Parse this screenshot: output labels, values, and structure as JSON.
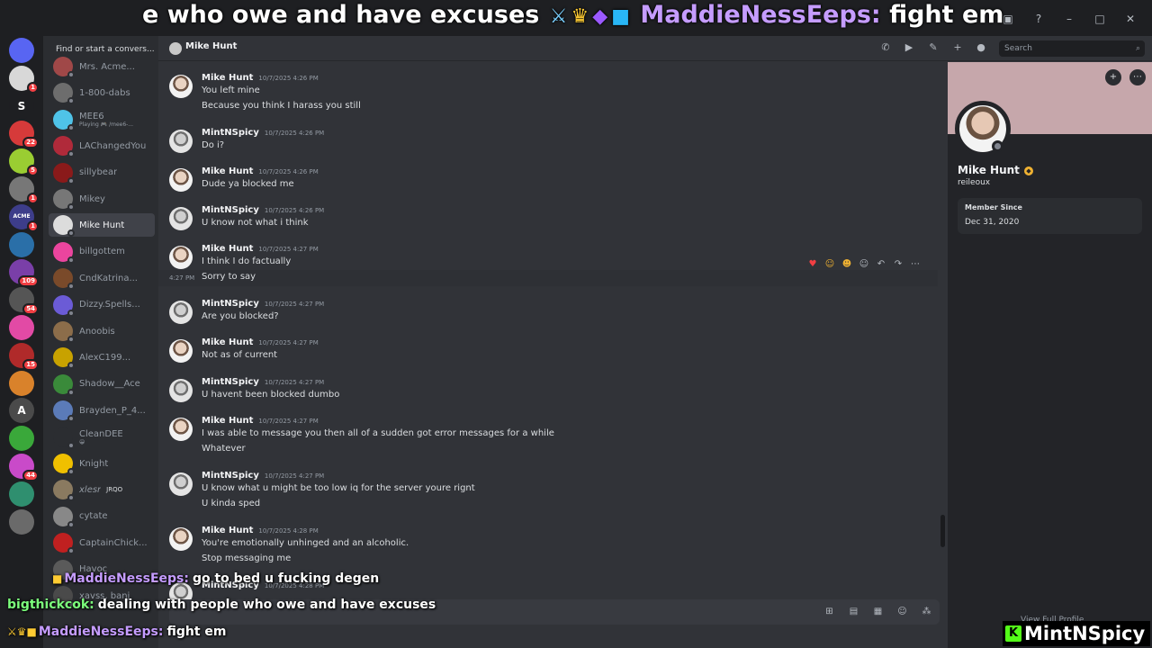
{
  "ticker": {
    "lead_text": "e who owe and have excuses",
    "username": "MaddieNessEeps:",
    "message": "fight em"
  },
  "dm_sidebar": {
    "find_placeholder": "Find or start a convers...",
    "items": [
      {
        "name": "Mrs. Acme...",
        "sub": "",
        "avatar_color": "#a04848"
      },
      {
        "name": "1-800-dabs",
        "sub": "",
        "avatar_color": "#6d6d6d"
      },
      {
        "name": "MEE6",
        "sub": "Playing 🎮 /mee6-...",
        "avatar_color": "#4fc3e8"
      },
      {
        "name": "LAChangedYou",
        "sub": "",
        "avatar_color": "#b02a3a"
      },
      {
        "name": "sillybear",
        "sub": "",
        "avatar_color": "#8a1a1a"
      },
      {
        "name": "Mikey",
        "sub": "",
        "avatar_color": "#777777"
      },
      {
        "name": "Mike Hunt",
        "sub": "",
        "avatar_color": "#dcdcdc"
      },
      {
        "name": "billgottem",
        "sub": "",
        "avatar_color": "#eb459e"
      },
      {
        "name": "CndKatrina...",
        "sub": "",
        "avatar_color": "#7a4a2a"
      },
      {
        "name": "Dizzy.Spells...",
        "sub": "",
        "avatar_color": "#6b5bd6"
      },
      {
        "name": "Anoobis",
        "sub": "",
        "avatar_color": "#8c6d4a"
      },
      {
        "name": "AlexC199...",
        "sub": "",
        "avatar_color": "#c8a200"
      },
      {
        "name": "Shadow__Ace",
        "sub": "",
        "avatar_color": "#3a8a3a"
      },
      {
        "name": "Brayden_P_4...",
        "sub": "",
        "avatar_color": "#5b7bb8"
      },
      {
        "name": "CleanDEE",
        "sub": "😀",
        "avatar_color": "#2b2d31"
      },
      {
        "name": "Knight",
        "sub": "",
        "avatar_color": "#f0c000"
      },
      {
        "name": "xlesr",
        "sub": "",
        "avatar_color": "#8a7a60",
        "tag": "JRQO"
      },
      {
        "name": "cytate",
        "sub": "",
        "avatar_color": "#888888"
      },
      {
        "name": "CaptainChick...",
        "sub": "",
        "avatar_color": "#c02020"
      },
      {
        "name": "Havoc",
        "sub": "",
        "avatar_color": "#5a5a5a"
      },
      {
        "name": "xavss, banj",
        "sub": "",
        "avatar_color": "#4a4a4a"
      }
    ]
  },
  "guilds": [
    {
      "label": "",
      "color": "#5865f2",
      "badge": "",
      "icon": "discord-icon"
    },
    {
      "label": "",
      "color": "#d8d8d8",
      "badge": "1"
    },
    {
      "label": "S",
      "color": "#1e1f22",
      "badge": ""
    },
    {
      "label": "",
      "color": "#d63a3a",
      "badge": "22"
    },
    {
      "label": "",
      "color": "#9acd32",
      "badge": "5"
    },
    {
      "label": "",
      "color": "#777777",
      "badge": "1"
    },
    {
      "label": "ACME",
      "color": "#3d3d8a",
      "badge": "1"
    },
    {
      "label": "",
      "color": "#2a6fa8",
      "badge": ""
    },
    {
      "label": "",
      "color": "#7a3fa8",
      "badge": "109"
    },
    {
      "label": "",
      "color": "#555555",
      "badge": "54"
    },
    {
      "label": "",
      "color": "#e24aa5",
      "badge": ""
    },
    {
      "label": "",
      "color": "#b02a2a",
      "badge": "15"
    },
    {
      "label": "",
      "color": "#d9822b",
      "badge": ""
    },
    {
      "label": "A",
      "color": "#4a4a4a",
      "badge": ""
    },
    {
      "label": "",
      "color": "#3aa83a",
      "badge": ""
    },
    {
      "label": "",
      "color": "#c94ac9",
      "badge": "44"
    },
    {
      "label": "",
      "color": "#2f8f6f",
      "badge": ""
    },
    {
      "label": "",
      "color": "#6a6a6a",
      "badge": ""
    }
  ],
  "header": {
    "title": "Mike Hunt",
    "search_placeholder": "Search"
  },
  "messages": [
    {
      "author": "Mike Hunt",
      "avatar": "mike",
      "time": "10/7/2025 4:26 PM",
      "lines": [
        "You left mine",
        "Because you think I harass you still"
      ]
    },
    {
      "author": "MintNSpicy",
      "avatar": "mint",
      "time": "10/7/2025 4:26 PM",
      "lines": [
        "Do i?"
      ]
    },
    {
      "author": "Mike Hunt",
      "avatar": "mike",
      "time": "10/7/2025 4:26 PM",
      "lines": [
        "Dude ya blocked me"
      ]
    },
    {
      "author": "MintNSpicy",
      "avatar": "mint",
      "time": "10/7/2025 4:26 PM",
      "lines": [
        "U know not what i think"
      ]
    },
    {
      "author": "Mike Hunt",
      "avatar": "mike",
      "time": "10/7/2025 4:27 PM",
      "lines": [
        "I think I do factually",
        "Sorry to say"
      ]
    },
    {
      "author": "MintNSpicy",
      "avatar": "mint",
      "time": "10/7/2025 4:27 PM",
      "lines": [
        "Are you blocked?"
      ]
    },
    {
      "author": "Mike Hunt",
      "avatar": "mike",
      "time": "10/7/2025 4:27 PM",
      "lines": [
        "Not as of current"
      ]
    },
    {
      "author": "MintNSpicy",
      "avatar": "mint",
      "time": "10/7/2025 4:27 PM",
      "lines": [
        "U havent been blocked dumbo"
      ]
    },
    {
      "author": "Mike Hunt",
      "avatar": "mike",
      "time": "10/7/2025 4:27 PM",
      "lines": [
        "I was able to message you then all of a sudden got error messages for a while",
        "Whatever"
      ]
    },
    {
      "author": "MintNSpicy",
      "avatar": "mint",
      "time": "10/7/2025 4:27 PM",
      "lines": [
        "U know what u might be too low iq for the server youre rignt",
        "U kinda sped"
      ]
    },
    {
      "author": "Mike Hunt",
      "avatar": "mike",
      "time": "10/7/2025 4:28 PM",
      "lines": [
        "You're emotionally unhinged and an alcoholic.",
        "Stop messaging me"
      ]
    },
    {
      "author": "MintNSpicy",
      "avatar": "mint",
      "time": "10/7/2025 4:28 PM",
      "lines": []
    }
  ],
  "hover": {
    "time": "4:27 PM"
  },
  "profile": {
    "display_name": "Mike Hunt",
    "username": "reileoux",
    "member_since_label": "Member Since",
    "member_since_date": "Dec 31, 2020",
    "view_full": "View Full Profile"
  },
  "overlay_chat": [
    {
      "user": "MaddieNessEeps:",
      "user_color": "#c59cff",
      "message": "go to bed u fucking degen"
    },
    {
      "user": "bigthickcok:",
      "user_color": "#7cff7c",
      "message": "dealing with people who owe and have excuses"
    },
    {
      "user": "MaddieNessEeps:",
      "user_color": "#c59cff",
      "message": "fight em"
    }
  ],
  "brand": {
    "name": "MintNSpicy",
    "logo": "K"
  }
}
